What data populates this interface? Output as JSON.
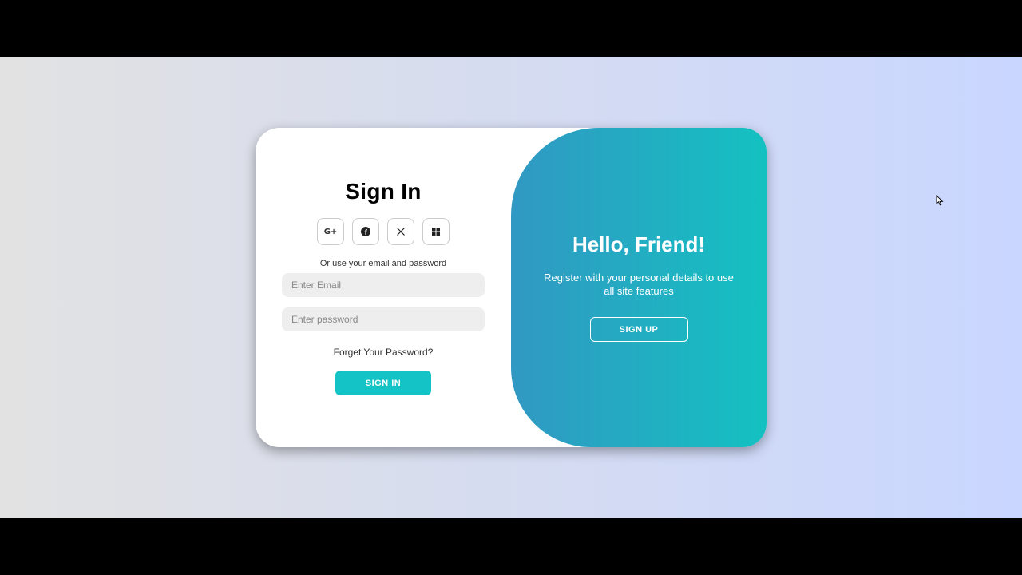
{
  "signin": {
    "title": "Sign In",
    "social": [
      {
        "icon": "google-plus-icon",
        "label": "G+"
      },
      {
        "icon": "facebook-icon"
      },
      {
        "icon": "x-icon"
      },
      {
        "icon": "windows-icon"
      }
    ],
    "alt_text": "Or use your email and password",
    "email_placeholder": "Enter Email",
    "password_placeholder": "Enter password",
    "forgot_label": "Forget Your Password?",
    "button_label": "SIGN IN"
  },
  "toggle": {
    "title": "Hello, Friend!",
    "text": "Register with your personal details to use all site features",
    "button_label": "SIGN UP"
  },
  "colors": {
    "accent": "#14c3c5",
    "gradient_start": "#3198c3",
    "gradient_end": "#14c1c1",
    "background_left": "#e2e2e2",
    "background_right": "#c9d6ff"
  }
}
